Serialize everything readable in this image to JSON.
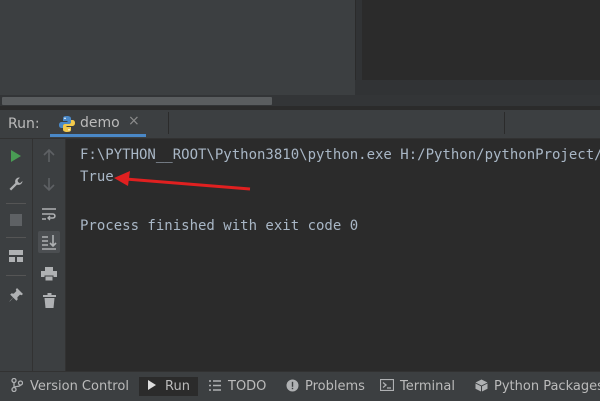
{
  "run_panel": {
    "run_label": "Run:",
    "tab": {
      "label": "demo",
      "close_glyph": "×",
      "icon": "python-icon"
    }
  },
  "left_toolbar": [
    {
      "name": "run-icon",
      "glyph": "▶",
      "color": "#499c54"
    },
    {
      "name": "wrench-icon",
      "glyph": "🔧"
    },
    {
      "name": "stop-icon",
      "glyph": "■",
      "disabled": true
    },
    {
      "name": "layout-icon",
      "glyph": "▤"
    },
    {
      "name": "pin-icon",
      "glyph": "📌"
    }
  ],
  "second_toolbar": [
    {
      "name": "scroll-up-icon",
      "glyph": "↑",
      "disabled": true
    },
    {
      "name": "scroll-down-icon",
      "glyph": "↓",
      "disabled": true
    },
    {
      "name": "soft-wrap-icon",
      "glyph": "⤶"
    },
    {
      "name": "scroll-to-end-icon",
      "glyph": "⤓",
      "active": true
    },
    {
      "name": "print-icon",
      "glyph": "⎙"
    },
    {
      "name": "trash-icon",
      "glyph": "🗑"
    }
  ],
  "console": {
    "lines": [
      "F:\\PYTHON__ROOT\\Python3810\\python.exe H:/Python/pythonProject/",
      "True",
      "",
      "Process finished with exit code 0"
    ],
    "annotation_color": "#e02020"
  },
  "status_bar": [
    {
      "label": "Version Control",
      "icon": "version-control-icon"
    },
    {
      "label": "Run",
      "icon": "run-icon",
      "active": true
    },
    {
      "label": "TODO",
      "icon": "todo-icon"
    },
    {
      "label": "Problems",
      "icon": "problems-icon"
    },
    {
      "label": "Terminal",
      "icon": "terminal-icon"
    },
    {
      "label": "Python Packages",
      "icon": "python-packages-icon"
    }
  ],
  "colors": {
    "background": "#2b2b2b",
    "panel": "#3c3f41",
    "text": "#a9b7c6",
    "tab_underline": "#4a88c7",
    "run_green": "#499c54"
  }
}
